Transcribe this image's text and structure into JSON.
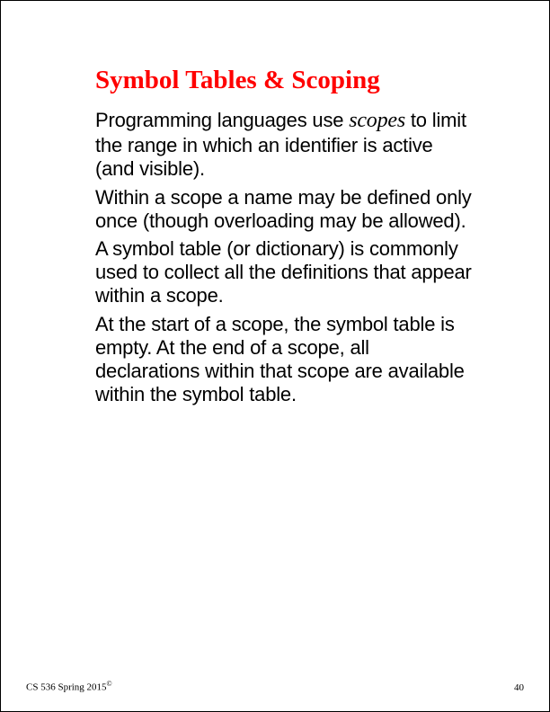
{
  "title": "Symbol Tables & Scoping",
  "p1_pre": "Programming languages use ",
  "p1_em": "scopes",
  "p1_post": " to limit the range in which an identifier is active (and visible).",
  "p2": "Within a scope a name may be defined only once (though overloading may be allowed).",
  "p3": "A symbol table (or dictionary) is commonly used to collect all the definitions that appear within a scope.",
  "p4": "At the start of a scope, the symbol table is empty. At the end of a scope, all declarations within that scope are available within the symbol table.",
  "footer_course": "CS 536  Spring 2015",
  "footer_mark": "©",
  "page_number": "40"
}
